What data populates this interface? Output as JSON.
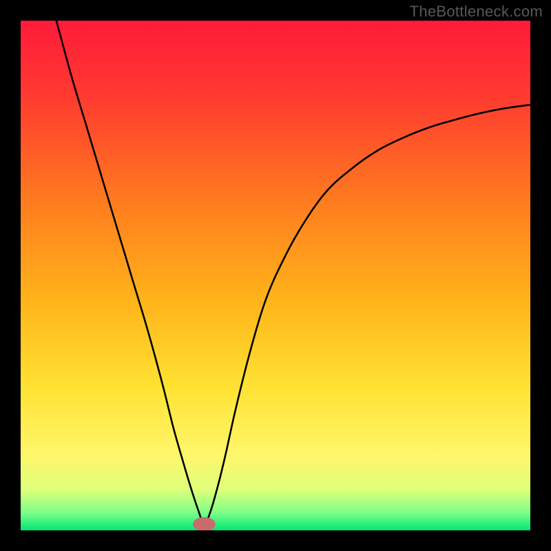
{
  "watermark": "TheBottleneck.com",
  "colors": {
    "black": "#000000",
    "curve": "#000000",
    "marker_fill": "#c76b6b",
    "marker_stroke": "#9c4646",
    "gradient_stops": [
      {
        "offset": 0.0,
        "color": "#ff1a3a"
      },
      {
        "offset": 0.15,
        "color": "#ff3b30"
      },
      {
        "offset": 0.35,
        "color": "#ff7a1f"
      },
      {
        "offset": 0.55,
        "color": "#ffb41a"
      },
      {
        "offset": 0.72,
        "color": "#ffe233"
      },
      {
        "offset": 0.85,
        "color": "#fff66a"
      },
      {
        "offset": 0.92,
        "color": "#dfff7a"
      },
      {
        "offset": 0.965,
        "color": "#7eff88"
      },
      {
        "offset": 1.0,
        "color": "#00e676"
      }
    ]
  },
  "chart_data": {
    "type": "line",
    "title": "",
    "xlabel": "",
    "ylabel": "",
    "xlim": [
      0,
      100
    ],
    "ylim": [
      0,
      100
    ],
    "grid": false,
    "legend": false,
    "notes": "V-shaped curve over a vertical red→orange→yellow→green gradient. Minimum (optimum) is at x≈36, y≈0. No axis tick labels are visible.",
    "annotations": {
      "watermark": "TheBottleneck.com",
      "watermark_position": "top-right"
    },
    "marker": {
      "x": 36,
      "y": 1.2,
      "rx": 2.2,
      "ry": 1.4
    },
    "series": [
      {
        "name": "bottleneck-curve",
        "x": [
          7,
          10,
          13,
          16,
          19,
          22,
          25,
          28,
          30,
          32,
          33.5,
          35,
          36,
          37,
          38.5,
          40,
          42,
          45,
          48,
          52,
          56,
          60,
          65,
          70,
          75,
          80,
          85,
          90,
          95,
          100
        ],
        "y": [
          100,
          89,
          79,
          69,
          59,
          49,
          39,
          28,
          20,
          13,
          8,
          3.5,
          1,
          3,
          8,
          14,
          23,
          35,
          45,
          54,
          61,
          66.5,
          71,
          74.5,
          77,
          79,
          80.5,
          81.8,
          82.8,
          83.5
        ]
      }
    ]
  }
}
